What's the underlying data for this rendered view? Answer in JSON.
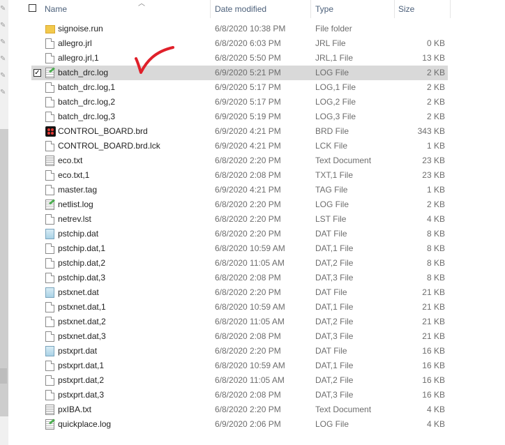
{
  "columns": {
    "name": "Name",
    "date": "Date modified",
    "type": "Type",
    "size": "Size"
  },
  "files": [
    {
      "name": "signoise.run",
      "date": "6/8/2020 10:38 PM",
      "type": "File folder",
      "size": "",
      "icon": "folder-icon",
      "selected": false
    },
    {
      "name": "allegro.jrl",
      "date": "6/8/2020 6:03 PM",
      "type": "JRL File",
      "size": "0 KB",
      "icon": "file-icon",
      "selected": false
    },
    {
      "name": "allegro.jrl,1",
      "date": "6/8/2020 5:50 PM",
      "type": "JRL,1 File",
      "size": "13 KB",
      "icon": "file-icon",
      "selected": false
    },
    {
      "name": "batch_drc.log",
      "date": "6/9/2020 5:21 PM",
      "type": "LOG File",
      "size": "2 KB",
      "icon": "log-icon",
      "selected": true
    },
    {
      "name": "batch_drc.log,1",
      "date": "6/9/2020 5:17 PM",
      "type": "LOG,1 File",
      "size": "2 KB",
      "icon": "file-icon",
      "selected": false
    },
    {
      "name": "batch_drc.log,2",
      "date": "6/9/2020 5:17 PM",
      "type": "LOG,2 File",
      "size": "2 KB",
      "icon": "file-icon",
      "selected": false
    },
    {
      "name": "batch_drc.log,3",
      "date": "6/9/2020 5:19 PM",
      "type": "LOG,3 File",
      "size": "2 KB",
      "icon": "file-icon",
      "selected": false
    },
    {
      "name": "CONTROL_BOARD.brd",
      "date": "6/9/2020 4:21 PM",
      "type": "BRD File",
      "size": "343 KB",
      "icon": "brd-icon",
      "selected": false
    },
    {
      "name": "CONTROL_BOARD.brd.lck",
      "date": "6/9/2020 4:21 PM",
      "type": "LCK File",
      "size": "1 KB",
      "icon": "file-icon",
      "selected": false
    },
    {
      "name": "eco.txt",
      "date": "6/8/2020 2:20 PM",
      "type": "Text Document",
      "size": "23 KB",
      "icon": "text-icon",
      "selected": false
    },
    {
      "name": "eco.txt,1",
      "date": "6/8/2020 2:08 PM",
      "type": "TXT,1 File",
      "size": "23 KB",
      "icon": "file-icon",
      "selected": false
    },
    {
      "name": "master.tag",
      "date": "6/9/2020 4:21 PM",
      "type": "TAG File",
      "size": "1 KB",
      "icon": "file-icon",
      "selected": false
    },
    {
      "name": "netlist.log",
      "date": "6/8/2020 2:20 PM",
      "type": "LOG File",
      "size": "2 KB",
      "icon": "log-icon",
      "selected": false
    },
    {
      "name": "netrev.lst",
      "date": "6/8/2020 2:20 PM",
      "type": "LST File",
      "size": "4 KB",
      "icon": "file-icon",
      "selected": false
    },
    {
      "name": "pstchip.dat",
      "date": "6/8/2020 2:20 PM",
      "type": "DAT File",
      "size": "8 KB",
      "icon": "dat-icon",
      "selected": false
    },
    {
      "name": "pstchip.dat,1",
      "date": "6/8/2020 10:59 AM",
      "type": "DAT,1 File",
      "size": "8 KB",
      "icon": "file-icon",
      "selected": false
    },
    {
      "name": "pstchip.dat,2",
      "date": "6/8/2020 11:05 AM",
      "type": "DAT,2 File",
      "size": "8 KB",
      "icon": "file-icon",
      "selected": false
    },
    {
      "name": "pstchip.dat,3",
      "date": "6/8/2020 2:08 PM",
      "type": "DAT,3 File",
      "size": "8 KB",
      "icon": "file-icon",
      "selected": false
    },
    {
      "name": "pstxnet.dat",
      "date": "6/8/2020 2:20 PM",
      "type": "DAT File",
      "size": "21 KB",
      "icon": "dat-icon",
      "selected": false
    },
    {
      "name": "pstxnet.dat,1",
      "date": "6/8/2020 10:59 AM",
      "type": "DAT,1 File",
      "size": "21 KB",
      "icon": "file-icon",
      "selected": false
    },
    {
      "name": "pstxnet.dat,2",
      "date": "6/8/2020 11:05 AM",
      "type": "DAT,2 File",
      "size": "21 KB",
      "icon": "file-icon",
      "selected": false
    },
    {
      "name": "pstxnet.dat,3",
      "date": "6/8/2020 2:08 PM",
      "type": "DAT,3 File",
      "size": "21 KB",
      "icon": "file-icon",
      "selected": false
    },
    {
      "name": "pstxprt.dat",
      "date": "6/8/2020 2:20 PM",
      "type": "DAT File",
      "size": "16 KB",
      "icon": "dat-icon",
      "selected": false
    },
    {
      "name": "pstxprt.dat,1",
      "date": "6/8/2020 10:59 AM",
      "type": "DAT,1 File",
      "size": "16 KB",
      "icon": "file-icon",
      "selected": false
    },
    {
      "name": "pstxprt.dat,2",
      "date": "6/8/2020 11:05 AM",
      "type": "DAT,2 File",
      "size": "16 KB",
      "icon": "file-icon",
      "selected": false
    },
    {
      "name": "pstxprt.dat,3",
      "date": "6/8/2020 2:08 PM",
      "type": "DAT,3 File",
      "size": "16 KB",
      "icon": "file-icon",
      "selected": false
    },
    {
      "name": "pxIBA.txt",
      "date": "6/8/2020 2:20 PM",
      "type": "Text Document",
      "size": "4 KB",
      "icon": "text-icon",
      "selected": false
    },
    {
      "name": "quickplace.log",
      "date": "6/9/2020 2:06 PM",
      "type": "LOG File",
      "size": "4 KB",
      "icon": "log-icon",
      "selected": false
    }
  ],
  "colors": {
    "selected_row": "#d9d9d9",
    "header_text": "#4c607a",
    "annotation": "#e0202a"
  }
}
